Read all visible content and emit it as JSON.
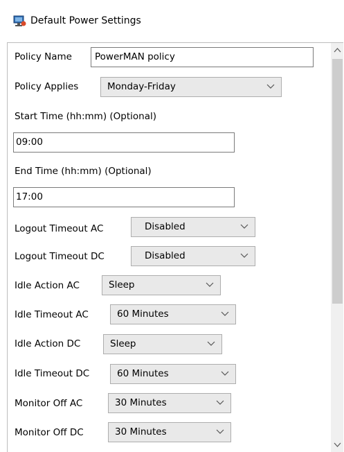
{
  "window": {
    "title": "Default Power Settings",
    "icon": "power-settings-icon"
  },
  "form": {
    "policy_name": {
      "label": "Policy Name",
      "value": "PowerMAN policy"
    },
    "policy_applies": {
      "label": "Policy Applies",
      "value": "Monday-Friday"
    },
    "start_time": {
      "label": "Start Time (hh:mm) (Optional)",
      "value": "09:00"
    },
    "end_time": {
      "label": "End Time (hh:mm) (Optional)",
      "value": "17:00"
    },
    "logout_timeout_ac": {
      "label": "Logout Timeout AC",
      "value": "Disabled"
    },
    "logout_timeout_dc": {
      "label": "Logout Timeout DC",
      "value": "Disabled"
    },
    "idle_action_ac": {
      "label": "Idle Action AC",
      "value": "Sleep"
    },
    "idle_timeout_ac": {
      "label": "Idle Timeout AC",
      "value": "60 Minutes"
    },
    "idle_action_dc": {
      "label": "Idle Action DC",
      "value": "Sleep"
    },
    "idle_timeout_dc": {
      "label": "Idle Timeout DC",
      "value": "60 Minutes"
    },
    "monitor_off_ac": {
      "label": "Monitor Off AC",
      "value": "30 Minutes"
    },
    "monitor_off_dc": {
      "label": "Monitor Off DC",
      "value": "30 Minutes"
    }
  }
}
